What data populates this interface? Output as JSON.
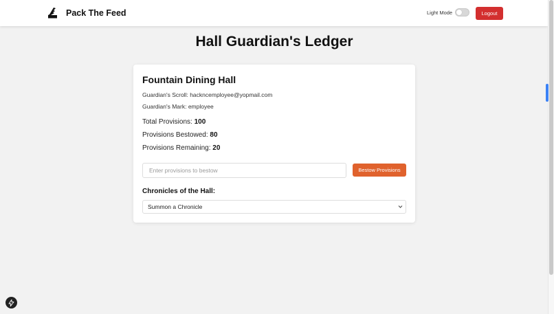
{
  "navbar": {
    "brand": "Pack The Feed",
    "theme_label": "Light Mode",
    "logout_label": "Logout"
  },
  "page": {
    "title": "Hall Guardian's Ledger"
  },
  "hall": {
    "name": "Fountain Dining Hall",
    "scroll_label": "Guardian's Scroll:",
    "scroll_value": "hackncemployee@yopmail.com",
    "mark_label": "Guardian's Mark:",
    "mark_value": "employee",
    "total_label": "Total Provisions:",
    "total_value": "100",
    "bestowed_label": "Provisions Bestowed:",
    "bestowed_value": "80",
    "remaining_label": "Provisions Remaining:",
    "remaining_value": "20"
  },
  "bestow": {
    "placeholder": "Enter provisions to bestow",
    "value": "",
    "button_label": "Bestow Provisions"
  },
  "chronicles": {
    "label": "Chronicles of the Hall:",
    "selected": "Summon a Chronicle"
  },
  "colors": {
    "logout": "#d32f2f",
    "bestow_button": "#e0622d",
    "side_tab": "#3b82f6"
  },
  "icons": {
    "brand": "boot-logo-icon",
    "select": "chevron-down-icon",
    "floating": "lightning-bolt-icon"
  }
}
